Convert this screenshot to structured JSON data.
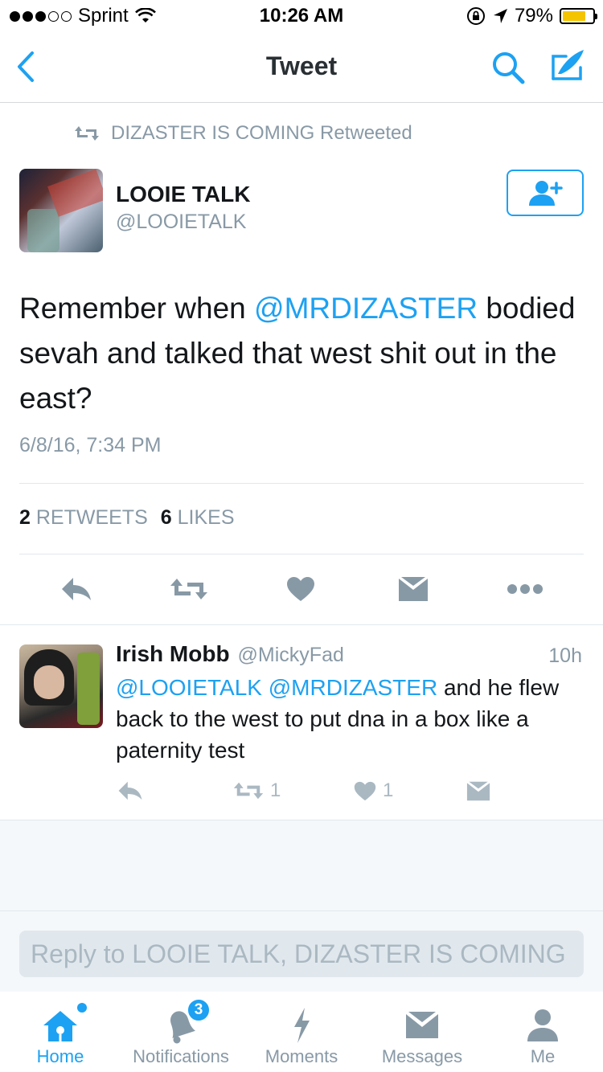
{
  "status_bar": {
    "carrier": "Sprint",
    "time": "10:26 AM",
    "battery_percent": "79%",
    "battery_level": 0.79,
    "battery_color": "#f5c400"
  },
  "nav": {
    "title": "Tweet",
    "back_icon": "chevron-left-icon",
    "search_icon": "search-icon",
    "compose_icon": "compose-icon"
  },
  "tweet": {
    "retweeted_by": "DIZASTER IS COMING Retweeted",
    "author_name": "LOOIE TALK",
    "author_handle": "@LOOIETALK",
    "text_before": "Remember when ",
    "mention": "@MRDIZASTER",
    "text_after": " bodied sevah and talked that west shit out in the east?",
    "date": "6/8/16, 7:34 PM",
    "retweet_count": "2",
    "retweets_label": "RETWEETS",
    "like_count": "6",
    "likes_label": "LIKES"
  },
  "reply": {
    "name": "Irish Mobb",
    "handle": "@MickyFad",
    "time": "10h",
    "mention1": "@LOOIETALK",
    "mention2": "@MRDIZASTER",
    "text": " and he flew back to the west to put dna in a box like a paternity test",
    "retweet_count": "1",
    "like_count": "1"
  },
  "reply_input": {
    "placeholder": "Reply to LOOIE TALK, DIZASTER IS COMING"
  },
  "tabs": [
    {
      "label": "Home",
      "icon": "home-icon",
      "active": true
    },
    {
      "label": "Notifications",
      "icon": "bell-icon",
      "badge": "3"
    },
    {
      "label": "Moments",
      "icon": "lightning-icon"
    },
    {
      "label": "Messages",
      "icon": "envelope-icon"
    },
    {
      "label": "Me",
      "icon": "person-icon"
    }
  ],
  "colors": {
    "accent": "#1da1f2",
    "secondary_text": "#8899a6",
    "icon_grey": "#8899a6"
  }
}
